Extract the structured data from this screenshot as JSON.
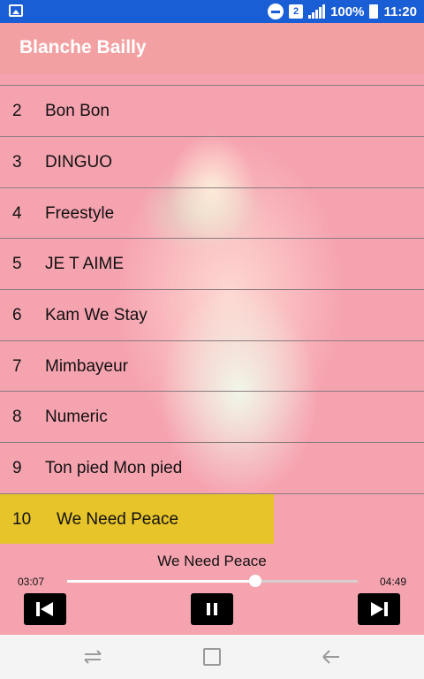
{
  "status_bar": {
    "sim_number": "2",
    "battery": "100%",
    "time": "11:20"
  },
  "app": {
    "title": "Blanche Bailly"
  },
  "tracks": [
    {
      "number": "2",
      "name": "Bon Bon"
    },
    {
      "number": "3",
      "name": "DINGUO"
    },
    {
      "number": "4",
      "name": "Freestyle"
    },
    {
      "number": "5",
      "name": "JE T AIME"
    },
    {
      "number": "6",
      "name": "Kam We Stay"
    },
    {
      "number": "7",
      "name": "Mimbayeur"
    },
    {
      "number": "8",
      "name": "Numeric"
    },
    {
      "number": "9",
      "name": "Ton pied Mon pied"
    },
    {
      "number": "10",
      "name": "We Need Peace"
    }
  ],
  "active_track_index": 8,
  "player": {
    "now_playing": "We Need Peace",
    "current_time": "03:07",
    "duration": "04:49",
    "progress": 0.647
  },
  "colors": {
    "status_bar": "#1a5ed6",
    "app_bar": "#f3a0a2",
    "list_background": "#f6a3b0",
    "active_row": "#e7c42a"
  }
}
